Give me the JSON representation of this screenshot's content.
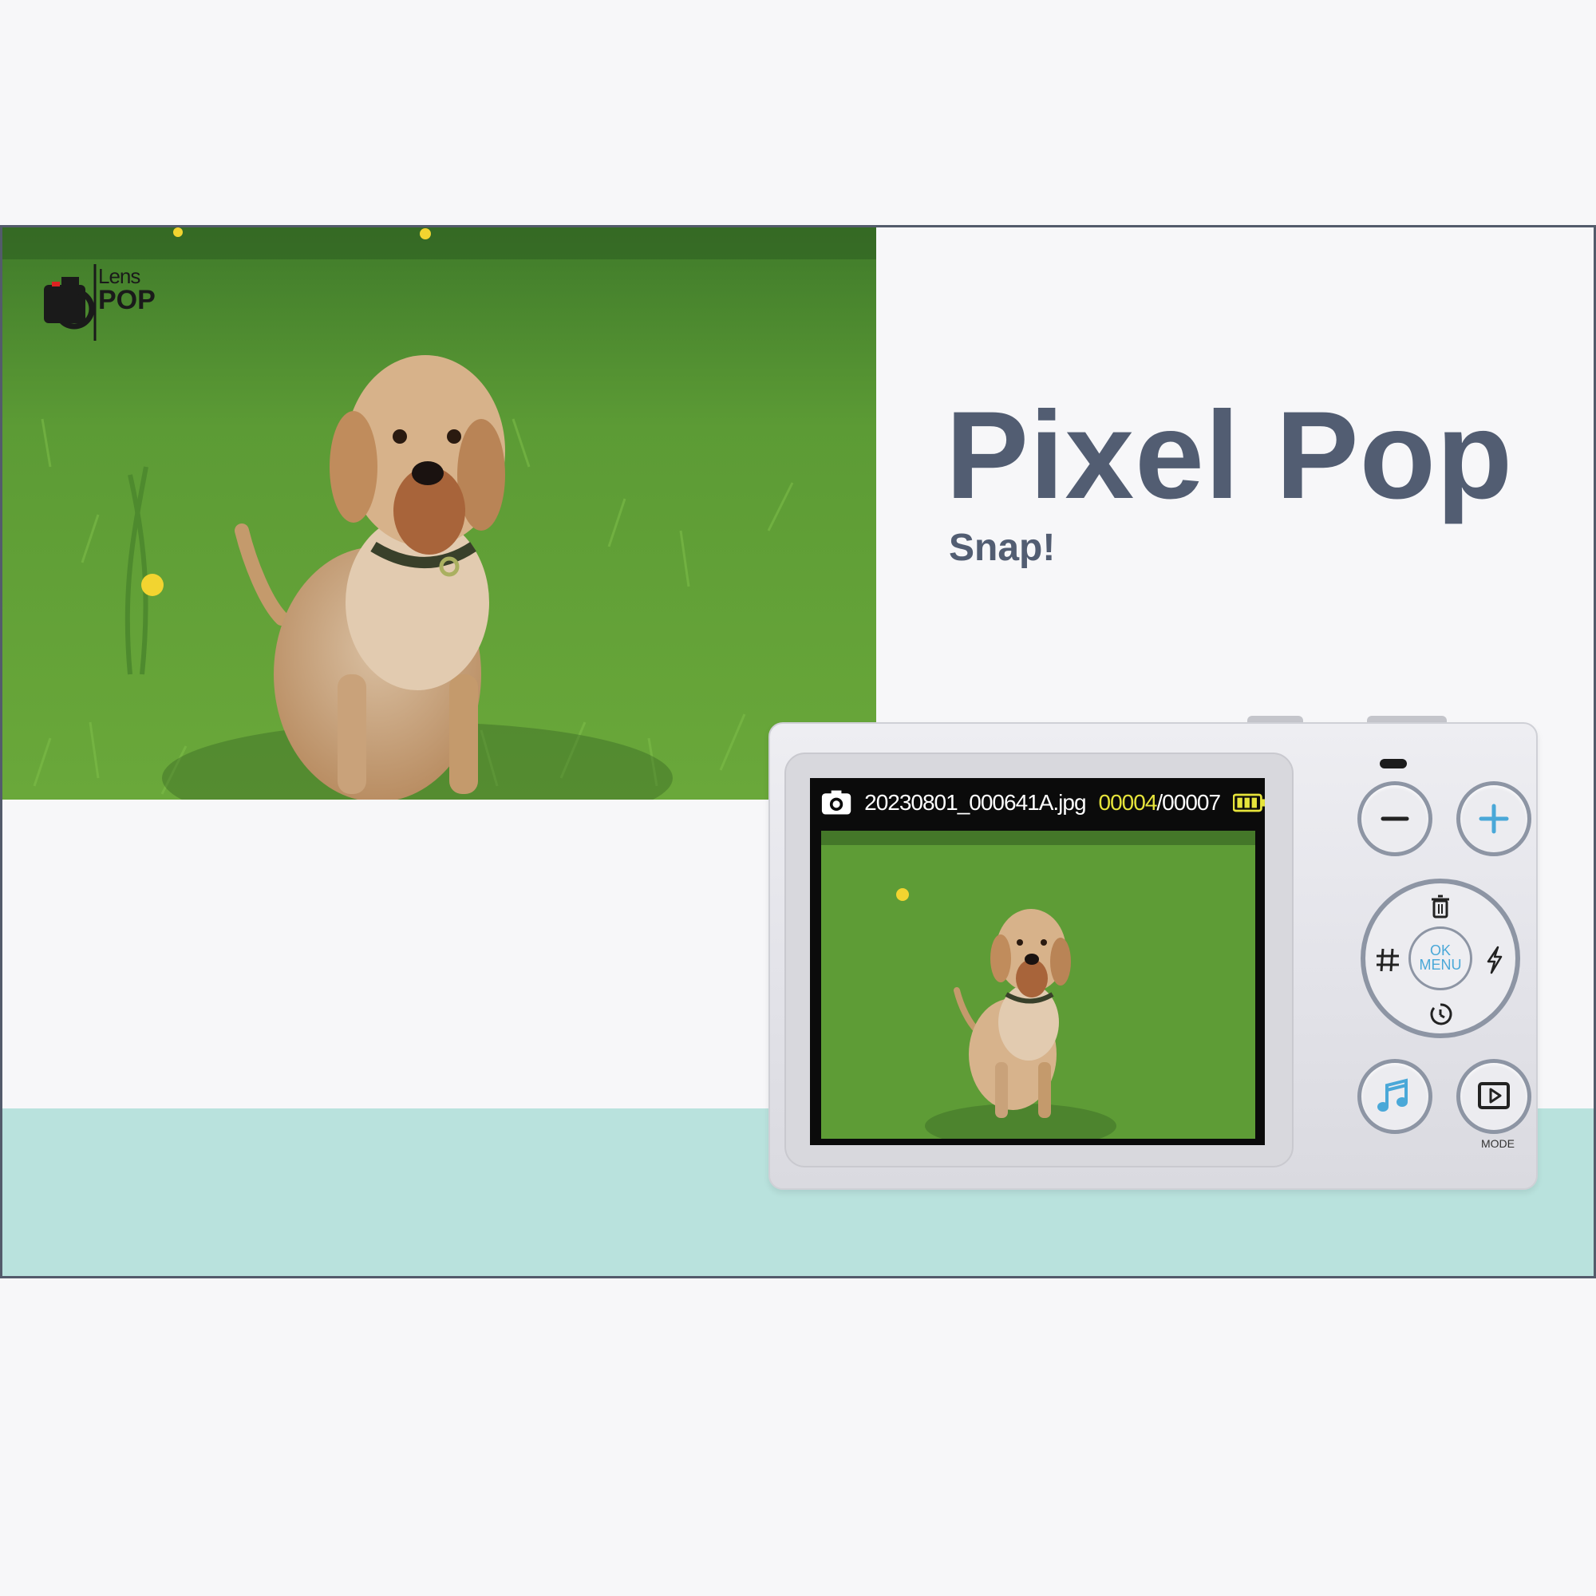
{
  "brand": {
    "lens": "Lens",
    "pop": "POP"
  },
  "headline": {
    "title": "Pixel Pop",
    "subtitle": "Snap!"
  },
  "camera": {
    "status": {
      "filename": "20230801_000641A.jpg",
      "current": "00004",
      "total": "/00007"
    },
    "dpad": {
      "ok": "OK",
      "menu": "MENU"
    },
    "mode_label": "MODE"
  },
  "colors": {
    "title": "#525d72",
    "teal_band": "#b9e2dd",
    "frame_border": "#535b6b",
    "accent_blue": "#4aa8d8",
    "counter_yellow": "#e6e43b"
  },
  "icons": [
    "camera-icon",
    "battery-icon",
    "minus-icon",
    "plus-icon",
    "trash-icon",
    "grid-icon",
    "flash-icon",
    "timer-icon",
    "music-icon",
    "play-icon"
  ]
}
